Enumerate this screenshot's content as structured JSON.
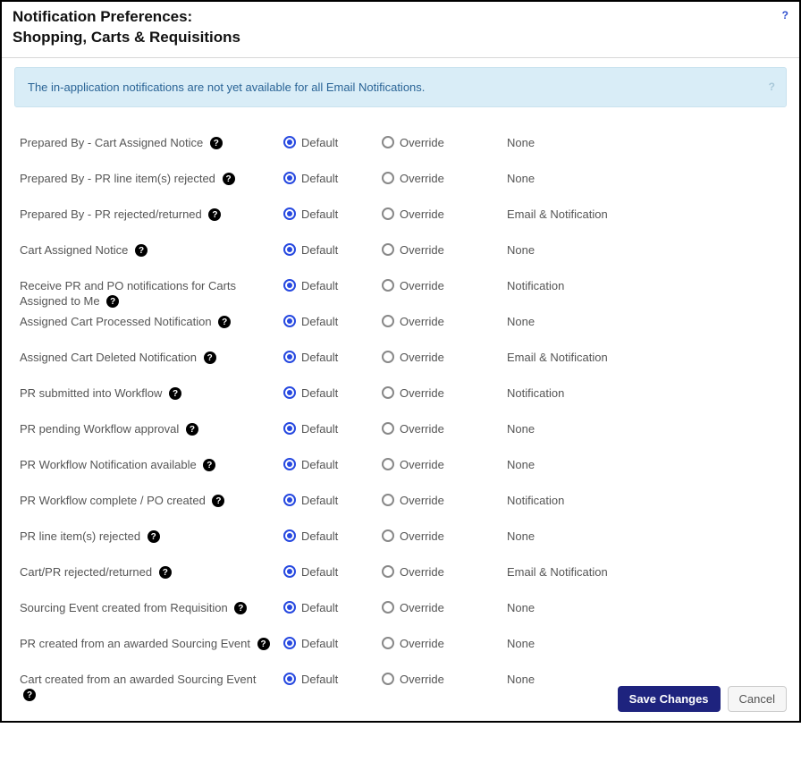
{
  "header": {
    "title_line1": "Notification Preferences:",
    "title_line2": "Shopping, Carts & Requisitions",
    "help_icon_label": "?"
  },
  "banner": {
    "text": "The in-application notifications are not yet available for all Email Notifications.",
    "help_icon": "?"
  },
  "radio_labels": {
    "default": "Default",
    "override": "Override"
  },
  "rows": [
    {
      "label": "Prepared By - Cart Assigned Notice",
      "selected": "default",
      "value": "None"
    },
    {
      "label": "Prepared By - PR line item(s) rejected",
      "selected": "default",
      "value": "None"
    },
    {
      "label": "Prepared By - PR rejected/returned",
      "selected": "default",
      "value": "Email & Notification"
    },
    {
      "label": "Cart Assigned Notice",
      "selected": "default",
      "value": "None"
    },
    {
      "label": "Receive PR and PO notifications for Carts Assigned to Me",
      "selected": "default",
      "value": "Notification"
    },
    {
      "label": "Assigned Cart Processed Notification",
      "selected": "default",
      "value": "None"
    },
    {
      "label": "Assigned Cart Deleted Notification",
      "selected": "default",
      "value": "Email & Notification"
    },
    {
      "label": "PR submitted into Workflow",
      "selected": "default",
      "value": "Notification"
    },
    {
      "label": "PR pending Workflow approval",
      "selected": "default",
      "value": "None"
    },
    {
      "label": "PR Workflow Notification available",
      "selected": "default",
      "value": "None"
    },
    {
      "label": "PR Workflow complete / PO created",
      "selected": "default",
      "value": "Notification"
    },
    {
      "label": "PR line item(s) rejected",
      "selected": "default",
      "value": "None"
    },
    {
      "label": "Cart/PR rejected/returned",
      "selected": "default",
      "value": "Email & Notification"
    },
    {
      "label": "Sourcing Event created from Requisition",
      "selected": "default",
      "value": "None"
    },
    {
      "label": "PR created from an awarded Sourcing Event",
      "selected": "default",
      "value": "None"
    },
    {
      "label": "Cart created from an awarded Sourcing Event",
      "selected": "default",
      "value": "None"
    }
  ],
  "footer": {
    "save_label": "Save Changes",
    "cancel_label": "Cancel"
  },
  "icons": {
    "question": "?"
  }
}
